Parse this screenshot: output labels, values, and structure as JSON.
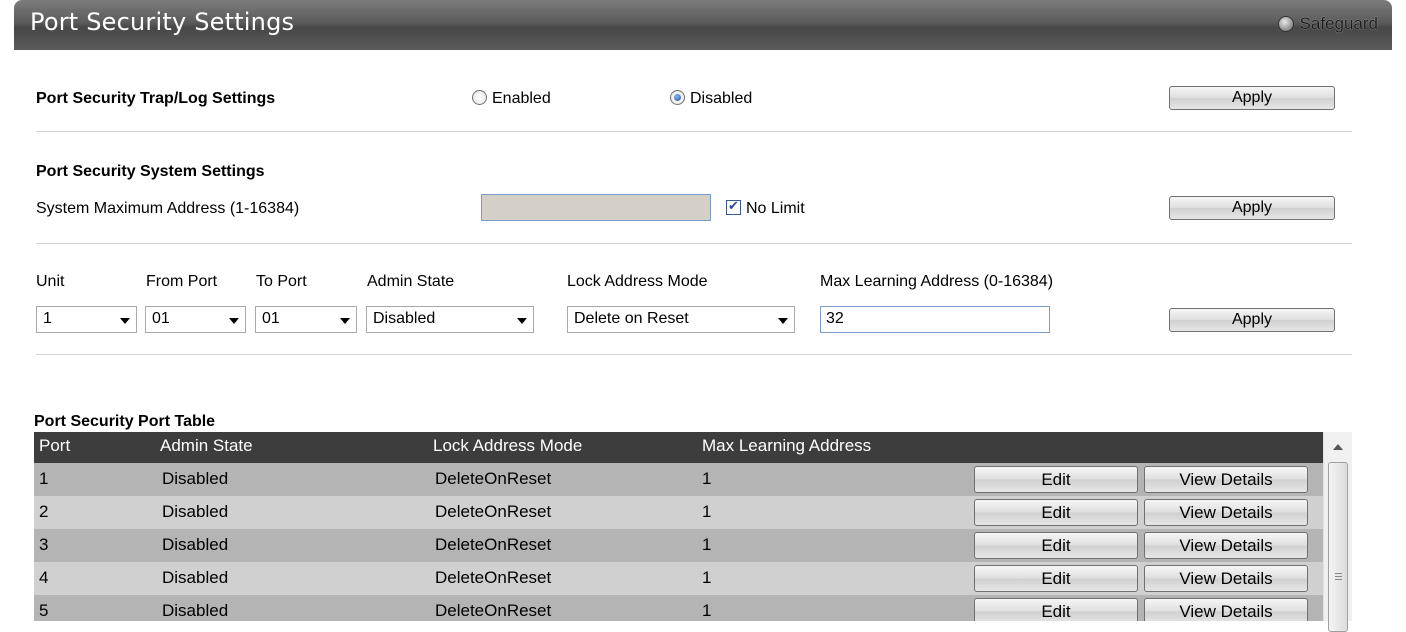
{
  "header": {
    "title": "Port Security Settings",
    "safeguard_label": "Safeguard"
  },
  "trap_log": {
    "label": "Port Security Trap/Log Settings",
    "options": [
      "Enabled",
      "Disabled"
    ],
    "selected": "Disabled",
    "apply_label": "Apply"
  },
  "system": {
    "section_label": "Port Security System Settings",
    "max_address_label": "System Maximum Address (1-16384)",
    "max_address_value": "",
    "no_limit_label": "No Limit",
    "no_limit_checked": true,
    "apply_label": "Apply"
  },
  "port_config": {
    "labels": {
      "unit": "Unit",
      "from_port": "From Port",
      "to_port": "To Port",
      "admin_state": "Admin State",
      "lock_mode": "Lock Address Mode",
      "max_learning": "Max Learning Address (0-16384)"
    },
    "values": {
      "unit": "1",
      "from_port": "01",
      "to_port": "01",
      "admin_state": "Disabled",
      "lock_mode": "Delete on Reset",
      "max_learning": "32"
    },
    "apply_label": "Apply"
  },
  "table": {
    "title": "Port Security Port Table",
    "columns": [
      "Port",
      "Admin State",
      "Lock Address Mode",
      "Max Learning Address"
    ],
    "edit_label": "Edit",
    "view_label": "View Details",
    "rows": [
      {
        "port": "1",
        "admin": "Disabled",
        "lock": "DeleteOnReset",
        "max": "1"
      },
      {
        "port": "2",
        "admin": "Disabled",
        "lock": "DeleteOnReset",
        "max": "1"
      },
      {
        "port": "3",
        "admin": "Disabled",
        "lock": "DeleteOnReset",
        "max": "1"
      },
      {
        "port": "4",
        "admin": "Disabled",
        "lock": "DeleteOnReset",
        "max": "1"
      },
      {
        "port": "5",
        "admin": "Disabled",
        "lock": "DeleteOnReset",
        "max": "1"
      }
    ]
  },
  "colors": {
    "title_bar": "#5b5b5b",
    "table_header": "#3d3d3d",
    "row_odd": "#b4b4b4",
    "row_even": "#d0d0d0"
  }
}
